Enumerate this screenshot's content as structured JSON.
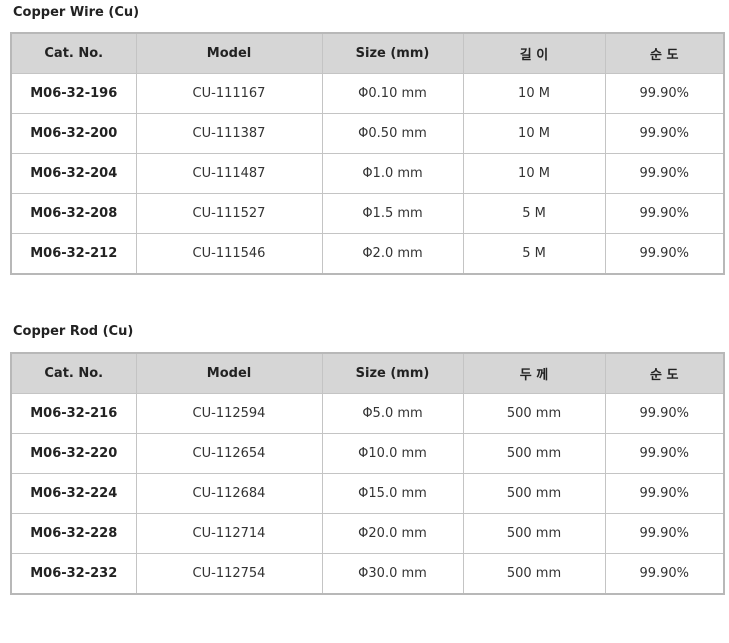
{
  "wire": {
    "title": "Copper Wire (Cu)",
    "headers": [
      "Cat. No.",
      "Model",
      "Size (mm)",
      "길 이",
      "순 도"
    ],
    "rows": [
      [
        "M06-32-196",
        "CU-111167",
        "Φ0.10 mm",
        "10 M",
        "99.90%"
      ],
      [
        "M06-32-200",
        "CU-111387",
        "Φ0.50 mm",
        "10 M",
        "99.90%"
      ],
      [
        "M06-32-204",
        "CU-111487",
        "Φ1.0 mm",
        "10 M",
        "99.90%"
      ],
      [
        "M06-32-208",
        "CU-111527",
        "Φ1.5 mm",
        "5 M",
        "99.90%"
      ],
      [
        "M06-32-212",
        "CU-111546",
        "Φ2.0 mm",
        "5 M",
        "99.90%"
      ]
    ]
  },
  "rod": {
    "title": "Copper Rod (Cu)",
    "headers": [
      "Cat. No.",
      "Model",
      "Size (mm)",
      "두 께",
      "순 도"
    ],
    "rows": [
      [
        "M06-32-216",
        "CU-112594",
        "Φ5.0 mm",
        "500 mm",
        "99.90%"
      ],
      [
        "M06-32-220",
        "CU-112654",
        "Φ10.0 mm",
        "500 mm",
        "99.90%"
      ],
      [
        "M06-32-224",
        "CU-112684",
        "Φ15.0 mm",
        "500 mm",
        "99.90%"
      ],
      [
        "M06-32-228",
        "CU-112714",
        "Φ20.0 mm",
        "500 mm",
        "99.90%"
      ],
      [
        "M06-32-232",
        "CU-112754",
        "Φ30.0 mm",
        "500 mm",
        "99.90%"
      ]
    ]
  }
}
